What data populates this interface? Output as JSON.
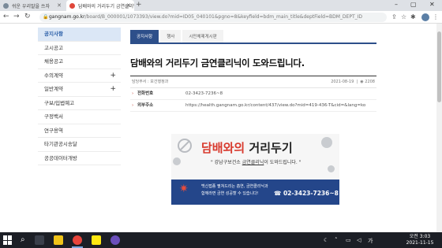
{
  "browser": {
    "tabs": [
      {
        "label": "쉬운 우리말을 쓰자",
        "active": false
      },
      {
        "label": "담배와의 거리두기 금연클리닉",
        "active": true
      }
    ],
    "new_tab": "+",
    "window_controls": {
      "minimize": "–",
      "maximize": "▢",
      "close": "✕"
    },
    "url_host": "gangnam.go.kr",
    "url_path": "/board/B_000001/1073393/view.do?mid=ID05_040101&pgno=8&keyfield=bdm_main_title&deptField=BDM_DEPT_ID"
  },
  "sidebar": {
    "items": [
      {
        "label": "공지사항",
        "active": true,
        "expand": false
      },
      {
        "label": "고시공고",
        "active": false,
        "expand": false
      },
      {
        "label": "채용공고",
        "active": false,
        "expand": false
      },
      {
        "label": "수의계약",
        "active": false,
        "expand": true
      },
      {
        "label": "일반계약",
        "active": false,
        "expand": true
      },
      {
        "label": "구보/입법예고",
        "active": false,
        "expand": false
      },
      {
        "label": "구정백서",
        "active": false,
        "expand": false
      },
      {
        "label": "연구용역",
        "active": false,
        "expand": false
      },
      {
        "label": "타기관공시송달",
        "active": false,
        "expand": false
      },
      {
        "label": "공공데이터개방",
        "active": false,
        "expand": false
      }
    ],
    "plus": "+"
  },
  "content": {
    "tabs": [
      "공지사항",
      "행사",
      "시민체제게시판"
    ],
    "title": "담배와의 거리두기 금연클리닉이 도와드립니다.",
    "meta_left": "담당부서 : 보건행정과",
    "meta_date": "2021-08-19",
    "meta_views": "2208",
    "rows": [
      {
        "label": "전화번호",
        "value": "02-3423-7236~8"
      },
      {
        "label": "외부주소",
        "value": "https://health.gangnam.go.kr/content/437/view.do?mid=419-436-T&cid=&lang=ko"
      }
    ]
  },
  "banner": {
    "title_red": "담배와의",
    "title_dark": " 거리두기",
    "subtitle_pre": "\" 강남구보건소 ",
    "subtitle_under": "금연클리닉",
    "subtitle_post": "이 도와드립니다. \"",
    "line1": "백신접종 펼쳐드리는 흡연, 금연클리닉과",
    "line2": "함께라면 금연 성공할 수 있습니다!",
    "phone": "☎ 02-3423-7236~8"
  },
  "taskbar": {
    "time": "오전 3:03",
    "date": "2021-11-15"
  }
}
